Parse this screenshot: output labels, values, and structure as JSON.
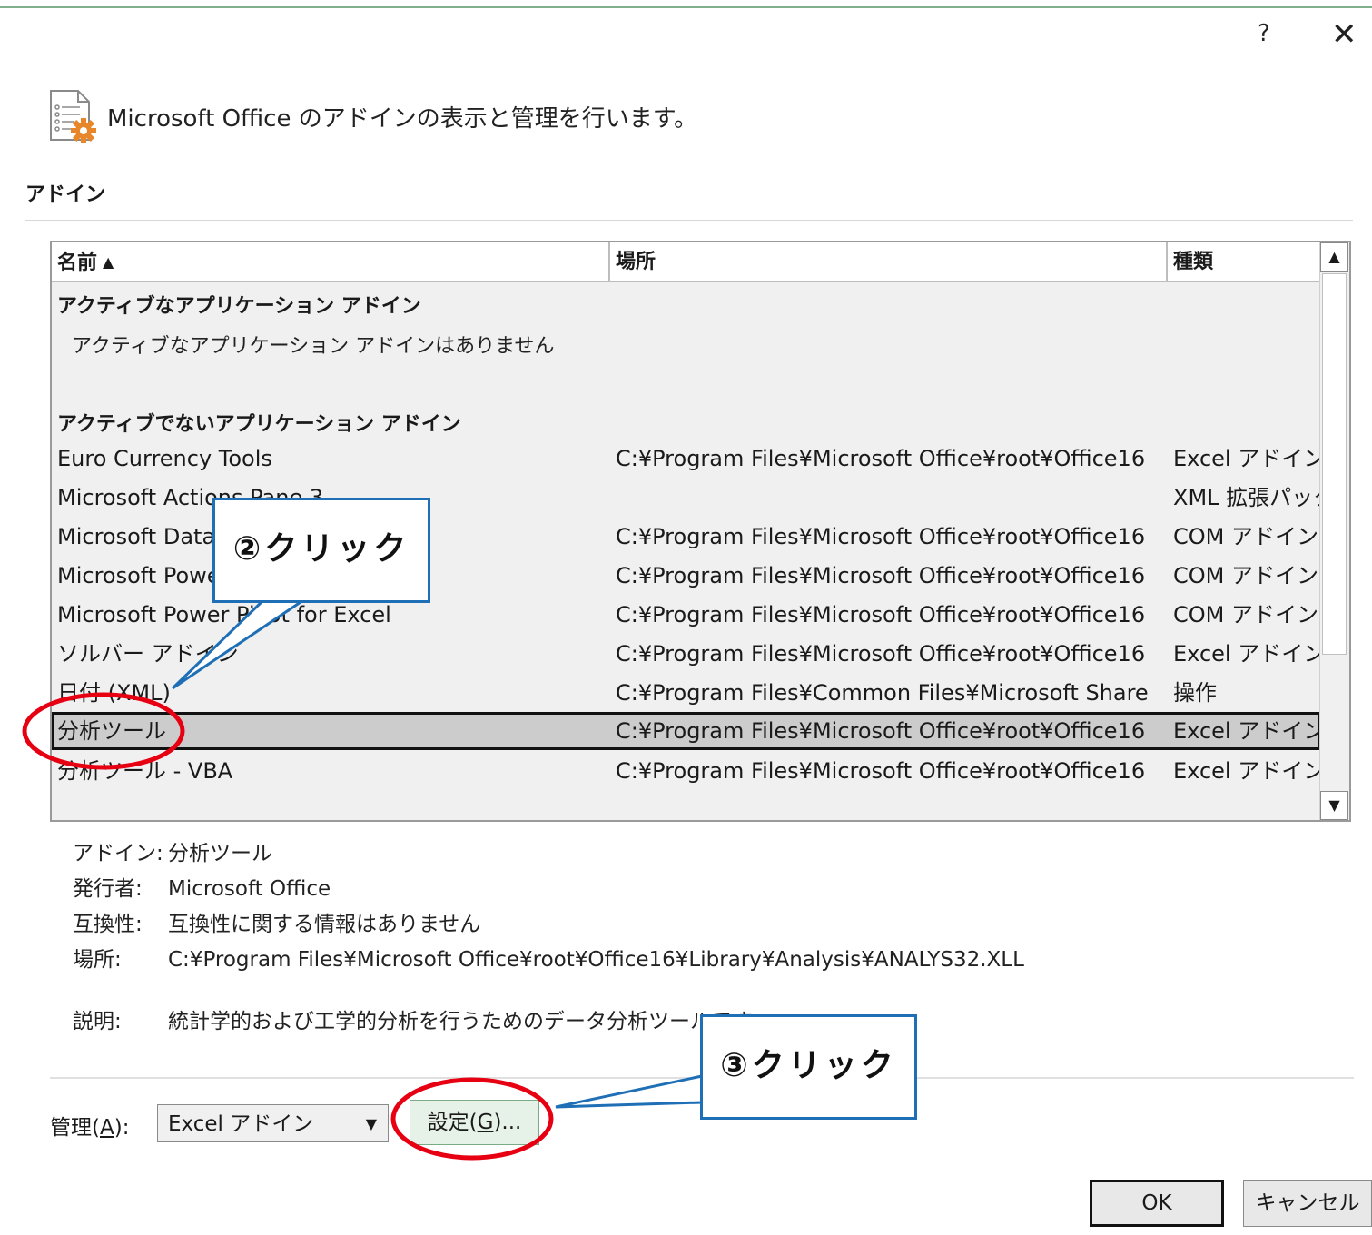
{
  "window": {
    "help_label": "?",
    "close_label": "✕"
  },
  "header": {
    "icon": "addin-document-gear-icon",
    "text": "Microsoft Office のアドインの表示と管理を行います。"
  },
  "section_label": "アドイン",
  "list": {
    "columns": [
      "名前",
      "場所",
      "種類"
    ],
    "sort_indicator": "▲",
    "active_group": "アクティブなアプリケーション アドイン",
    "active_empty": "アクティブなアプリケーション アドインはありません",
    "inactive_group": "アクティブでないアプリケーション アドイン",
    "rows": [
      {
        "name": "Euro Currency Tools",
        "location": "C:¥Program Files¥Microsoft Office¥root¥Office16",
        "type": "Excel アドイン"
      },
      {
        "name": "Microsoft Actions Pane 3",
        "location": "",
        "type": "XML 拡張パック"
      },
      {
        "name": "Microsoft Data Streamer for Excel",
        "location": "C:¥Program Files¥Microsoft Office¥root¥Office16",
        "type": "COM アドイン"
      },
      {
        "name": "Microsoft Power Map for Excel",
        "location": "C:¥Program Files¥Microsoft Office¥root¥Office16",
        "type": "COM アドイン"
      },
      {
        "name": "Microsoft Power Pivot for Excel",
        "location": "C:¥Program Files¥Microsoft Office¥root¥Office16",
        "type": "COM アドイン"
      },
      {
        "name": "ソルバー アドイン",
        "location": "C:¥Program Files¥Microsoft Office¥root¥Office16",
        "type": "Excel アドイン"
      },
      {
        "name": "日付 (XML)",
        "location": "C:¥Program Files¥Common Files¥Microsoft Share",
        "type": "操作"
      },
      {
        "name": "分析ツール",
        "location": "C:¥Program Files¥Microsoft Office¥root¥Office16",
        "type": "Excel アドイン"
      },
      {
        "name": "分析ツール - VBA",
        "location": "C:¥Program Files¥Microsoft Office¥root¥Office16",
        "type": "Excel アドイン"
      }
    ],
    "selected_index": 7,
    "scroll_up": "▲",
    "scroll_down": "▼"
  },
  "details": {
    "addin_label": "アドイン:",
    "addin_value": "分析ツール",
    "publisher_label": "発行者:",
    "publisher_value": "Microsoft Office",
    "compat_label": "互換性:",
    "compat_value": "互換性に関する情報はありません",
    "location_label": "場所:",
    "location_value": "C:¥Program Files¥Microsoft Office¥root¥Office16¥Library¥Analysis¥ANALYS32.XLL",
    "desc_label": "説明:",
    "desc_value": "統計学的および工学的分析を行うためのデータ分析ツールです"
  },
  "manage": {
    "label_prefix": "管理(",
    "label_key": "A",
    "label_suffix": "):",
    "selected": "Excel アドイン",
    "dropdown_arrow": "▼",
    "go_prefix": "設定(",
    "go_key": "G",
    "go_suffix": ")..."
  },
  "buttons": {
    "ok": "OK",
    "cancel": "キャンセル"
  },
  "annotations": {
    "callout_2": "②クリック",
    "callout_3": "③クリック",
    "highlight_color": "#e60012",
    "callout_border_color": "#1f6fb6"
  }
}
